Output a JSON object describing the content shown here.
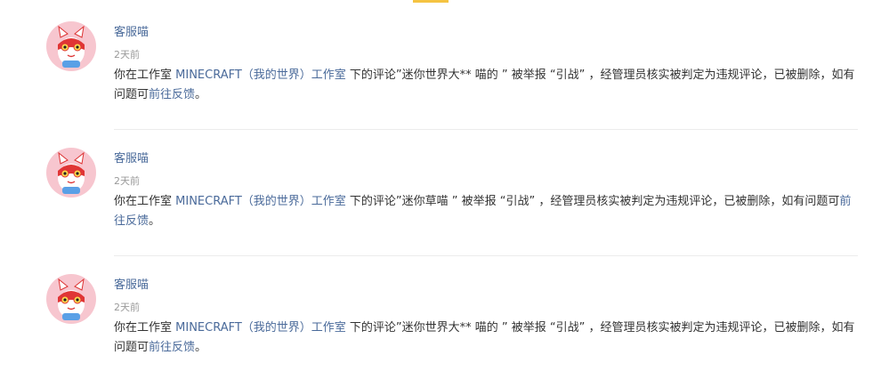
{
  "notifications": [
    {
      "sender": "客服喵",
      "time": "2天前",
      "text_before": "你在工作室 ",
      "studio_link": "MINECRAFT（我的世界）工作室",
      "text_middle": " 下的评论”迷你世界大** 喵的 ” 被举报 “引战” ，经管理员核实被判定为违规评论，已被删除，如有问题可",
      "feedback_link": "前往反馈",
      "text_end": "。"
    },
    {
      "sender": "客服喵",
      "time": "2天前",
      "text_before": "你在工作室 ",
      "studio_link": "MINECRAFT（我的世界）工作室",
      "text_middle": " 下的评论”迷你草喵 ” 被举报 “引战” ，经管理员核实被判定为违规评论，已被删除，如有问题可",
      "feedback_link": "前往反馈",
      "text_end": "。"
    },
    {
      "sender": "客服喵",
      "time": "2天前",
      "text_before": "你在工作室 ",
      "studio_link": "MINECRAFT（我的世界）工作室",
      "text_middle": " 下的评论”迷你世界大** 喵的 ” 被举报 “引战” ，经管理员核实被判定为违规评论，已被删除，如有问题可",
      "feedback_link": "前往反馈",
      "text_end": "。"
    }
  ],
  "colors": {
    "link": "#4a6a9a",
    "text": "#333333",
    "muted": "#9a9a9a",
    "accent": "#f5c342",
    "avatar_bg": "#f7c6cf"
  },
  "icons": {
    "avatar": "cat-mascot-icon"
  }
}
